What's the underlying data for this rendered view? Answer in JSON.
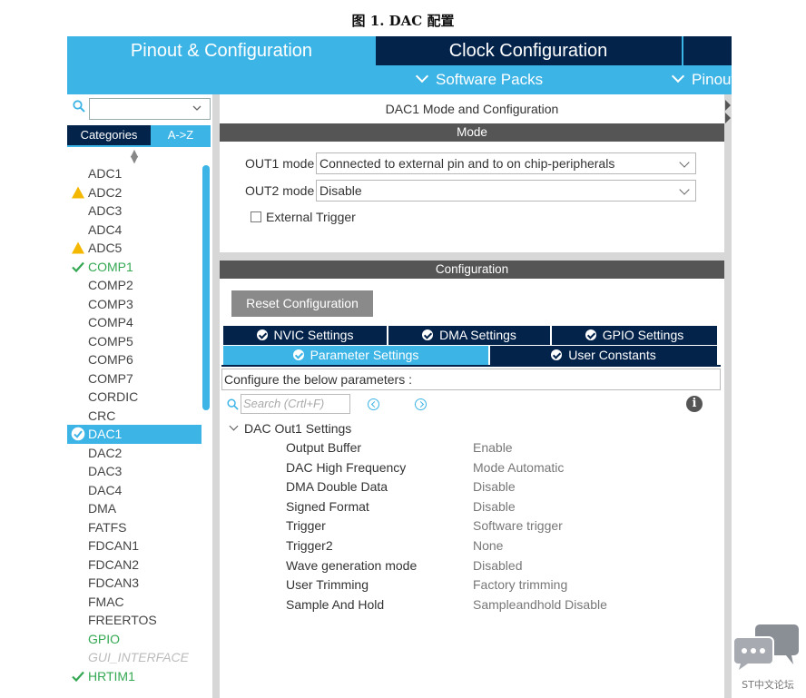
{
  "caption": "图 1. DAC 配置",
  "tabs": {
    "pinout": "Pinout & Configuration",
    "clock": "Clock Configuration"
  },
  "subbar": {
    "software_packs": "Software Packs",
    "pinout": "Pinout"
  },
  "left": {
    "categories_tab": "Categories",
    "az_tab": "A->Z",
    "items": [
      {
        "label": "ADC1",
        "status": "none"
      },
      {
        "label": "ADC2",
        "status": "warning"
      },
      {
        "label": "ADC3",
        "status": "none"
      },
      {
        "label": "ADC4",
        "status": "none"
      },
      {
        "label": "ADC5",
        "status": "warning"
      },
      {
        "label": "COMP1",
        "status": "ok"
      },
      {
        "label": "COMP2",
        "status": "none"
      },
      {
        "label": "COMP3",
        "status": "none"
      },
      {
        "label": "COMP4",
        "status": "none"
      },
      {
        "label": "COMP5",
        "status": "none"
      },
      {
        "label": "COMP6",
        "status": "none"
      },
      {
        "label": "COMP7",
        "status": "none"
      },
      {
        "label": "CORDIC",
        "status": "none"
      },
      {
        "label": "CRC",
        "status": "none"
      },
      {
        "label": "DAC1",
        "status": "selected"
      },
      {
        "label": "DAC2",
        "status": "none"
      },
      {
        "label": "DAC3",
        "status": "none"
      },
      {
        "label": "DAC4",
        "status": "none"
      },
      {
        "label": "DMA",
        "status": "none"
      },
      {
        "label": "FATFS",
        "status": "none"
      },
      {
        "label": "FDCAN1",
        "status": "none"
      },
      {
        "label": "FDCAN2",
        "status": "none"
      },
      {
        "label": "FDCAN3",
        "status": "none"
      },
      {
        "label": "FMAC",
        "status": "none"
      },
      {
        "label": "FREERTOS",
        "status": "none"
      },
      {
        "label": "GPIO",
        "status": "green"
      },
      {
        "label": "GUI_INTERFACE",
        "status": "disabled"
      },
      {
        "label": "HRTIM1",
        "status": "ok"
      }
    ]
  },
  "mode": {
    "title": "DAC1 Mode and Configuration",
    "header": "Mode",
    "out1_label": "OUT1 mode",
    "out1_value": "Connected to external pin and to on chip-peripherals",
    "out2_label": "OUT2 mode",
    "out2_value": "Disable",
    "external_trigger": "External Trigger"
  },
  "config": {
    "header": "Configuration",
    "reset_button": "Reset Configuration",
    "tabs": {
      "nvic": "NVIC Settings",
      "dma": "DMA Settings",
      "gpio": "GPIO Settings",
      "parameter": "Parameter Settings",
      "user_constants": "User Constants"
    },
    "configure_text": "Configure the below parameters :",
    "search_placeholder": "Search (Crtl+F)",
    "group": "DAC Out1 Settings",
    "params": [
      {
        "name": "Output Buffer",
        "value": "Enable"
      },
      {
        "name": "DAC High Frequency",
        "value": "Mode Automatic"
      },
      {
        "name": "DMA Double Data",
        "value": "Disable"
      },
      {
        "name": "Signed Format",
        "value": "Disable"
      },
      {
        "name": "Trigger",
        "value": "Software trigger"
      },
      {
        "name": "Trigger2",
        "value": "None"
      },
      {
        "name": "Wave generation mode",
        "value": "Disabled"
      },
      {
        "name": "User Trimming",
        "value": "Factory trimming"
      },
      {
        "name": "Sample And Hold",
        "value": "Sampleandhold Disable"
      }
    ]
  },
  "watermark": "ST中文论坛",
  "colors": {
    "accent": "#3cb4e6",
    "navy": "#03234b",
    "ok": "#34a853",
    "warning": "#f5b800"
  }
}
